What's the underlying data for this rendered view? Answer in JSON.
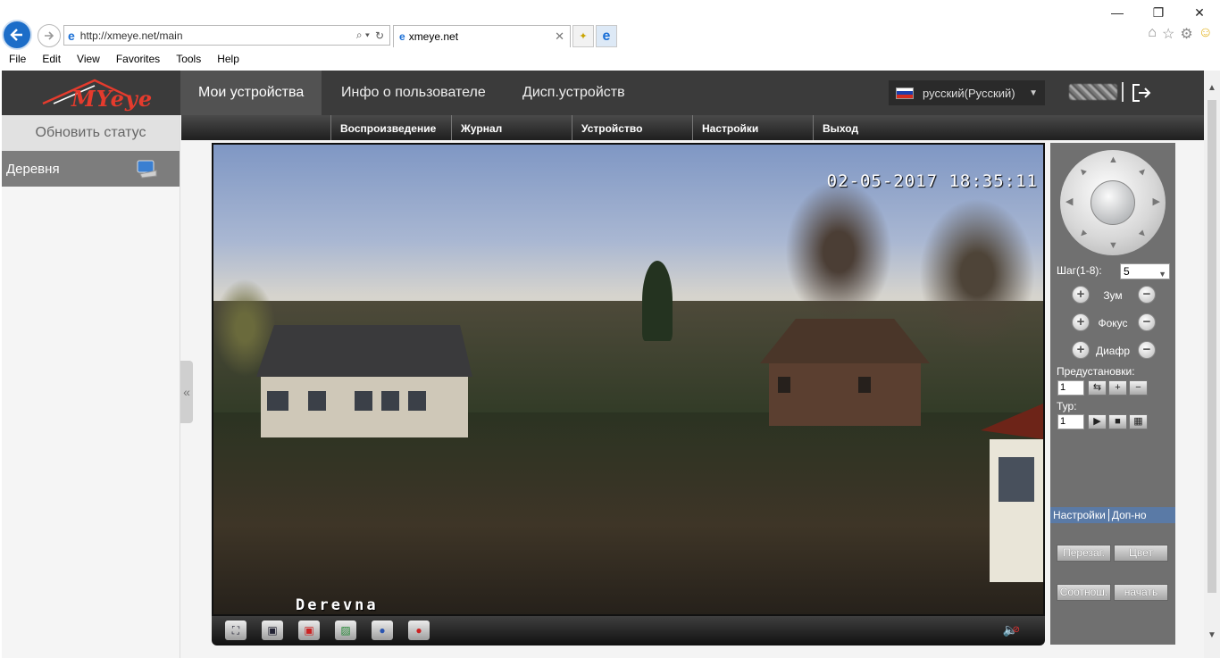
{
  "browser": {
    "url": "http://xmeye.net/main",
    "tab_title": "xmeye.net",
    "menu": [
      "File",
      "Edit",
      "View",
      "Favorites",
      "Tools",
      "Help"
    ]
  },
  "app": {
    "logo_text": "MYeye",
    "nav": [
      "Мои устройства",
      "Инфо о пользователе",
      "Дисп.устройств"
    ],
    "active_nav": 0,
    "language": "русский(Русский)",
    "subnav": [
      "Воспроизведение",
      "Журнал",
      "Устройство",
      "Настройки",
      "Выход"
    ],
    "sidebar": {
      "refresh_label": "Обновить статус",
      "device_name": "Деревня"
    },
    "video": {
      "timestamp": "02-05-2017 18:35:11",
      "camera_label": "Derevna"
    },
    "ptz": {
      "step_label": "Шаг(1-8):",
      "step_value": "5",
      "zoom_label": "Зум",
      "focus_label": "Фокус",
      "iris_label": "Диафр",
      "presets_label": "Предустановки:",
      "preset_value": "1",
      "tour_label": "Тур:",
      "tour_value": "1"
    },
    "panel_tabs": [
      "Настройки",
      "Доп-но"
    ],
    "panel_buttons": [
      "Перезаг.",
      "Цвет",
      "Соотнош.",
      "начать"
    ]
  }
}
